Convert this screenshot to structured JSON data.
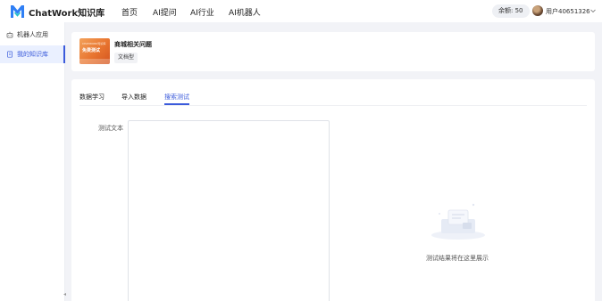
{
  "header": {
    "brand": "ChatWork知识库",
    "nav": [
      "首页",
      "AI提问",
      "AI行业",
      "AI机器人"
    ],
    "balance": "余额: 50",
    "username": "用户40651326"
  },
  "sidebar": {
    "items": [
      {
        "label": "机器人应用",
        "icon": "robot-icon"
      },
      {
        "label": "我的知识库",
        "icon": "book-icon"
      }
    ],
    "collapse_glyph": "◂"
  },
  "kb": {
    "thumb_top": "CHATWORK知识库",
    "thumb_main": "免费测试",
    "title": "商城相关问题",
    "type": "文档型"
  },
  "tabs": [
    "数据学习",
    "导入数据",
    "搜索测试"
  ],
  "active_tab": "搜索测试",
  "search_test": {
    "label": "测试文本",
    "value": "",
    "empty_message": "测试结果将在这里展示"
  },
  "colors": {
    "accent": "#3b5bdb",
    "background": "#f2f3f7"
  }
}
